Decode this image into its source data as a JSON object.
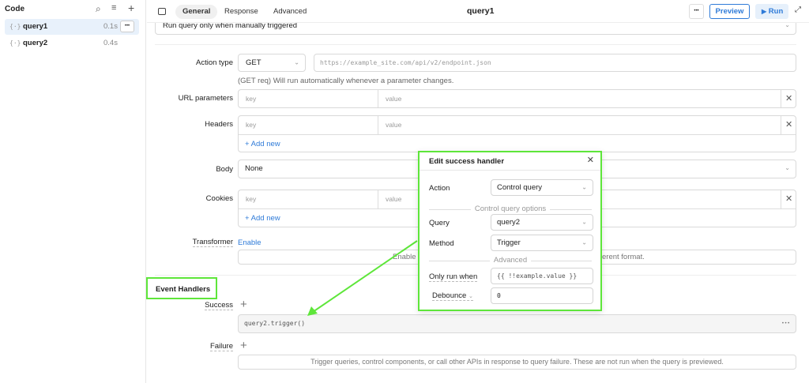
{
  "sidebar": {
    "title": "Code",
    "items": [
      {
        "name": "query1",
        "time": "0.1s",
        "more": "•••"
      },
      {
        "name": "query2",
        "time": "0.4s"
      }
    ]
  },
  "topbar": {
    "tabs": [
      "General",
      "Response",
      "Advanced"
    ],
    "title": "query1",
    "more": "•••",
    "preview": "Preview",
    "run": "Run"
  },
  "form": {
    "trigger_mode": "Run query only when manually triggered",
    "action_type_label": "Action type",
    "action_type": "GET",
    "url_placeholder": "https://example_site.com/api/v2/endpoint.json",
    "help": "(GET req) Will run automatically whenever a parameter changes.",
    "url_params_label": "URL parameters",
    "headers_label": "Headers",
    "body_label": "Body",
    "body_value": "None",
    "cookies_label": "Cookies",
    "key_placeholder": "key",
    "value_placeholder": "value",
    "add_new": "+ Add new",
    "transformer_label": "Transformer",
    "transformer_enable": "Enable",
    "transformer_hint_left": "Enable t",
    "transformer_hint_right": "erent format.",
    "event_handlers": "Event Handlers",
    "success_label": "Success",
    "success_handler": "query2.trigger()",
    "handler_more": "•••",
    "failure_label": "Failure",
    "failure_hint": "Trigger queries, control components, or call other APIs in response to query failure. These are not run when the query is previewed."
  },
  "popup": {
    "title": "Edit success handler",
    "action_label": "Action",
    "action": "Control query",
    "section1": "Control query options",
    "query_label": "Query",
    "query": "query2",
    "method_label": "Method",
    "method": "Trigger",
    "section2": "Advanced",
    "only_run_label": "Only run when",
    "only_run": "{{ !!example.value }}",
    "debounce_label": "Debounce",
    "debounce": "0"
  },
  "colors": {
    "highlight": "#5ee63a",
    "accent": "#2f7bd8",
    "selected": "#e8f1fb"
  }
}
